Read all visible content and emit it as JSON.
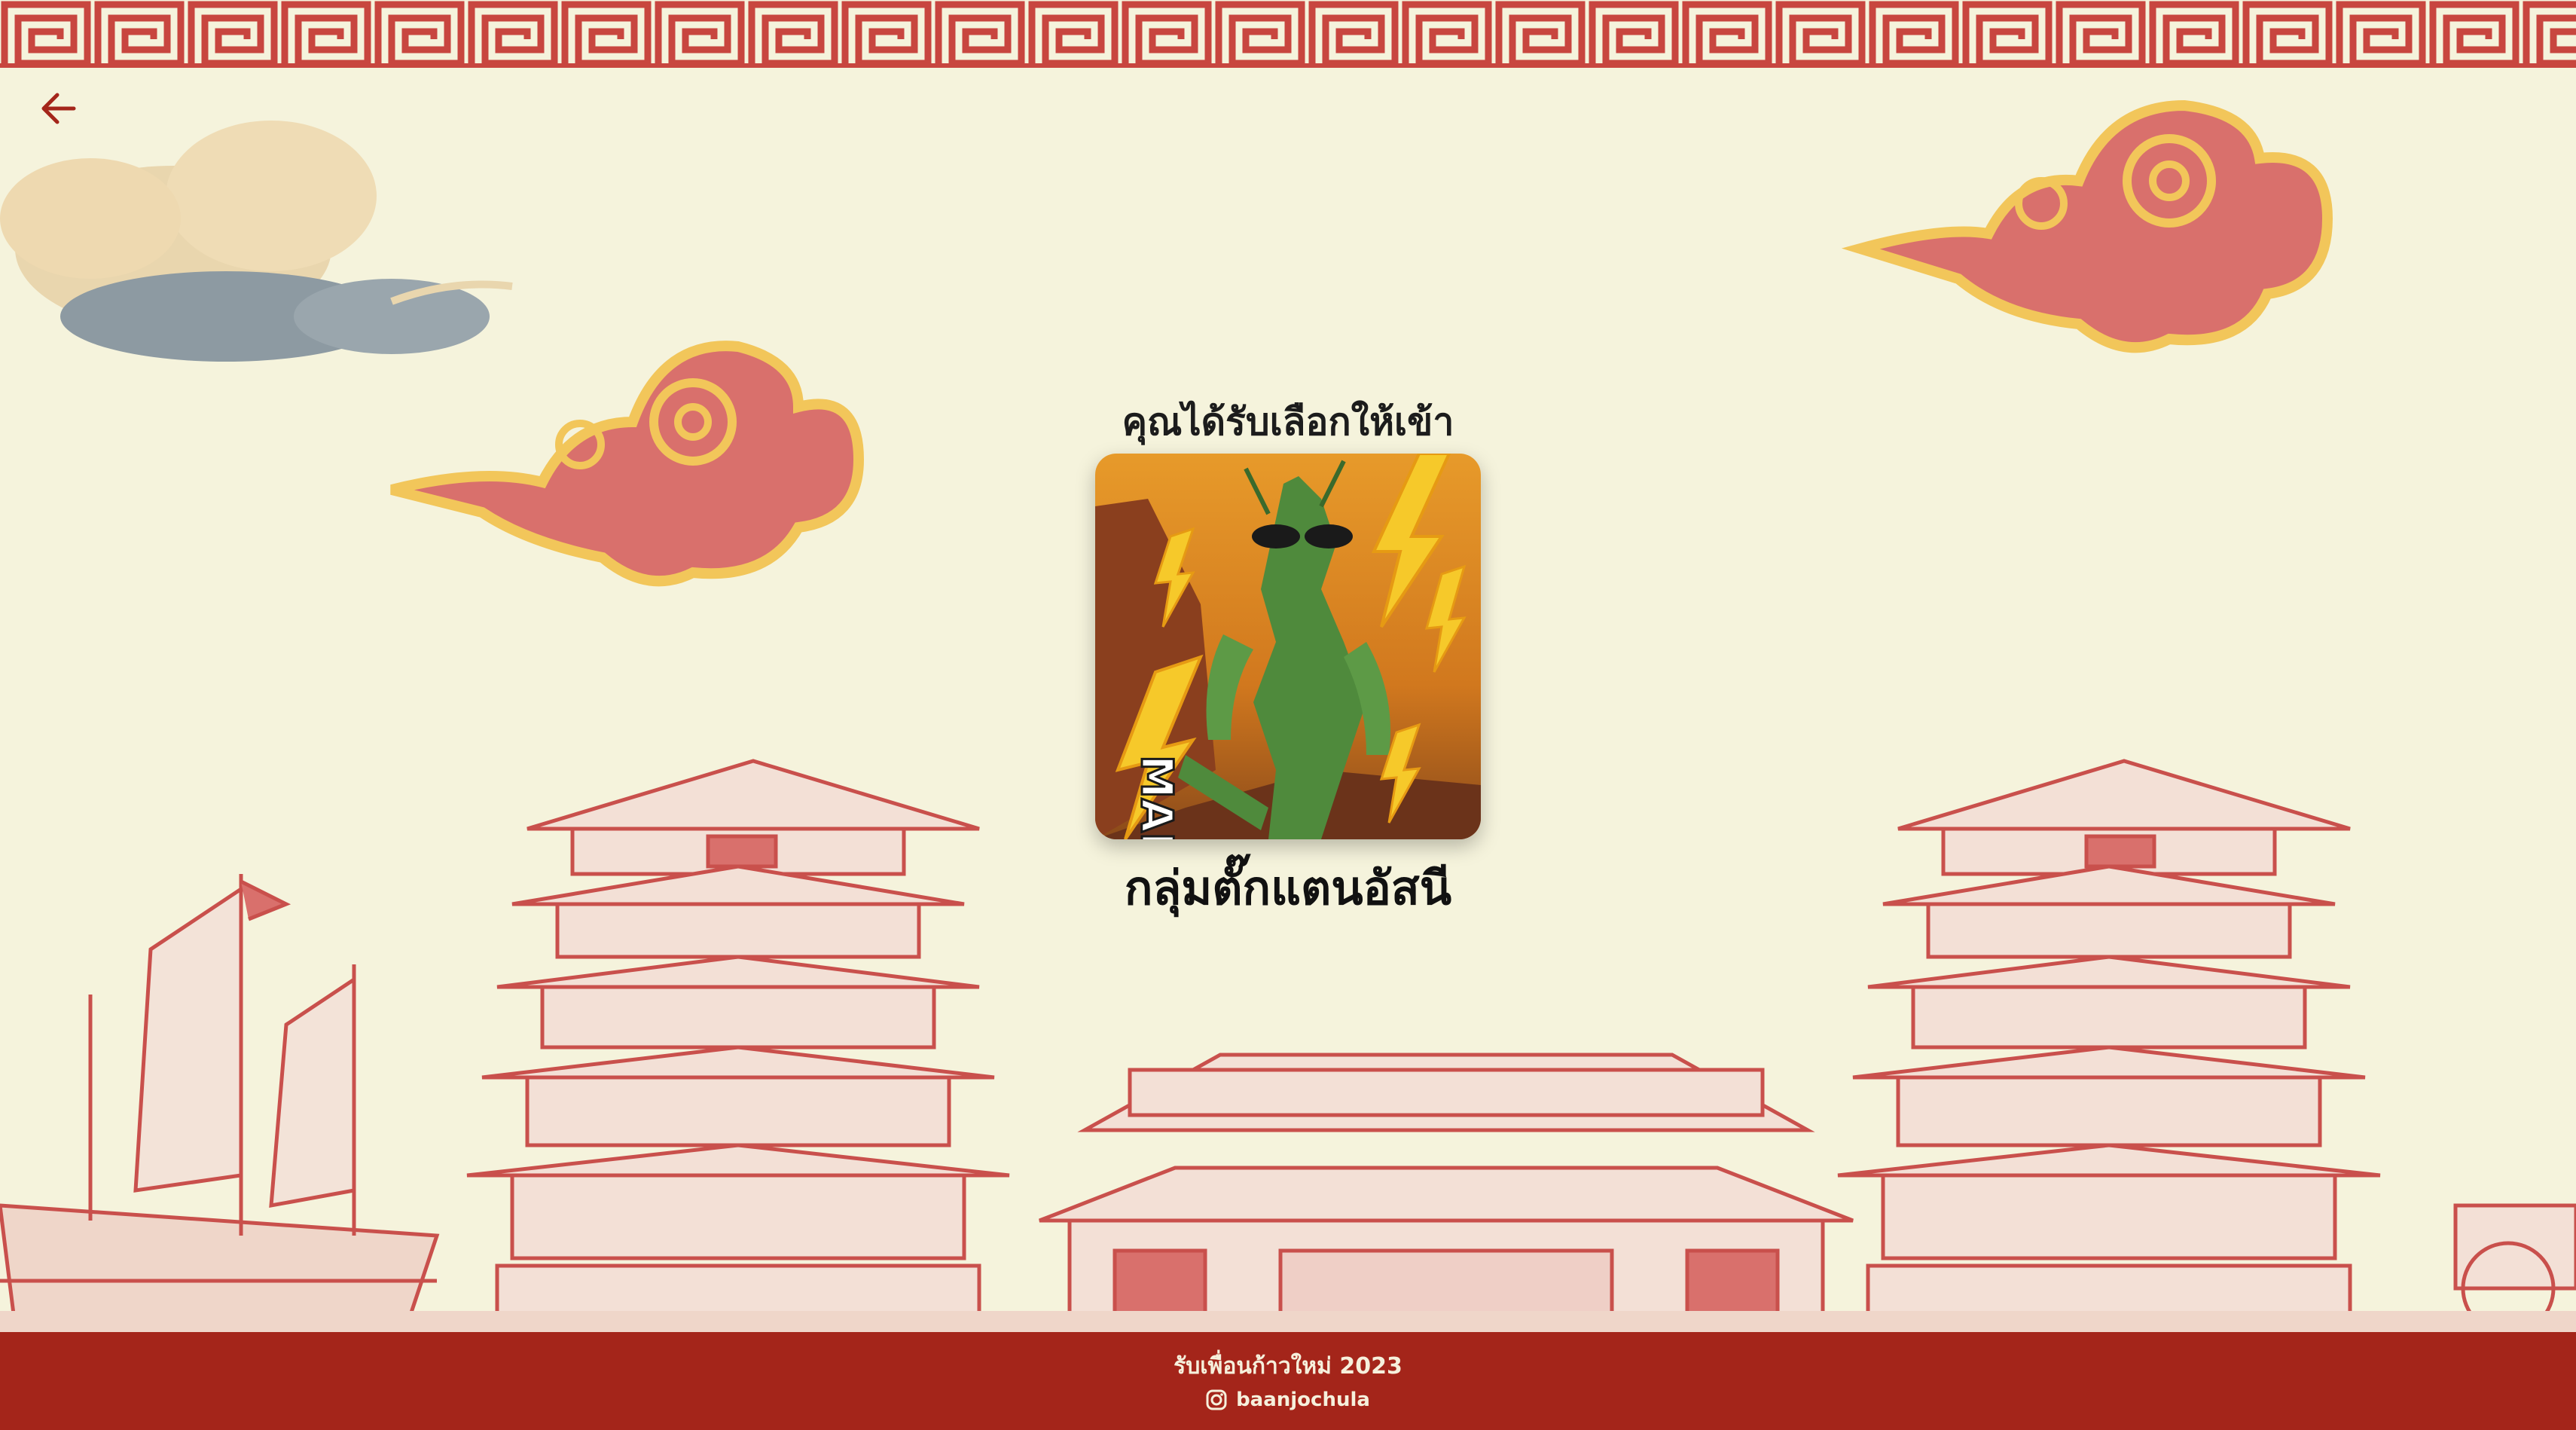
{
  "colors": {
    "background": "#f5f3dc",
    "accent_red": "#a4251a",
    "pattern_red": "#c8463f",
    "cloud_red": "#d9706c",
    "cloud_outline": "#f2c65a",
    "building_line": "#c9504c"
  },
  "header": {
    "back_icon": "arrow-left-icon"
  },
  "main": {
    "subtitle": "คุณได้รับเลือกให้เข้า",
    "group_name": "กลุ่มตั๊กแตนอัสนี",
    "card_text": "MANTIS",
    "card_image": "mantis-illustration"
  },
  "footer": {
    "line": "รับเพื่อนก้าวใหม่ 2023",
    "social_icon": "instagram-icon",
    "social_handle": "baanjochula"
  }
}
